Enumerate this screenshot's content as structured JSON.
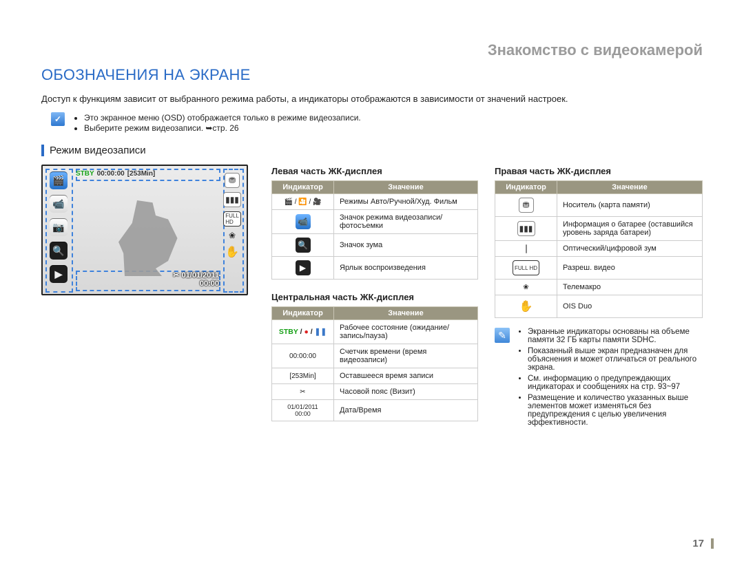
{
  "breadcrumb": "Знакомство с видеокамерой",
  "title": "ОБОЗНАЧЕНИЯ НА ЭКРАНЕ",
  "intro": "Доступ к функциям зависит от выбранного режима работы, а индикаторы отображаются в зависимости от значений настроек.",
  "topInfo": {
    "line1": "Это экранное меню (OSD) отображается только в режиме видеозаписи.",
    "line2": "Выберите режим видеозаписи. ➥стр. 26"
  },
  "sectionTitle": "Режим видеозаписи",
  "lcd": {
    "stby": "STBY",
    "time": "00:00:00",
    "remain": "[253Min]",
    "date": "01/01/2011",
    "clock": "00:00"
  },
  "tableHeaders": {
    "indicator": "Индикатор",
    "meaning": "Значение"
  },
  "left": {
    "title": "Левая часть ЖК-дисплея",
    "rows": [
      {
        "icon": "modes-icons",
        "label": "🎬 / 🎦 / 🎥",
        "meaning": "Режимы Авто/Ручной/Худ. Фильм"
      },
      {
        "icon": "video-mode-icon",
        "label": "📹",
        "meaning": "Значок режима видеозаписи/ фотосъемки"
      },
      {
        "icon": "zoom-icon",
        "label": "🔍",
        "meaning": "Значок зума"
      },
      {
        "icon": "play-icon",
        "label": "▶",
        "meaning": "Ярлык воспроизведения"
      }
    ]
  },
  "center": {
    "title": "Центральная часть ЖК-дисплея",
    "rows": [
      {
        "icon": "status-icon",
        "label_html": "STBY / ● / ❚❚",
        "meaning": "Рабочее состояние (ожидание/ запись/пауза)"
      },
      {
        "icon": "counter-icon",
        "label": "00:00:00",
        "meaning": "Счетчик времени (время видеозаписи)"
      },
      {
        "icon": "remain-icon",
        "label": "[253Min]",
        "meaning": "Оставшееся время записи"
      },
      {
        "icon": "timezone-icon",
        "label": "✂",
        "meaning": "Часовой пояс (Визит)"
      },
      {
        "icon": "datetime-icon",
        "label": "01/01/2011\n00:00",
        "meaning": "Дата/Время"
      }
    ]
  },
  "right": {
    "title": "Правая часть ЖК-дисплея",
    "rows": [
      {
        "icon": "sd-icon",
        "meaning": "Носитель (карта памяти)"
      },
      {
        "icon": "battery-icon",
        "meaning": "Информация о батарее (оставшийся уровень заряда батареи)"
      },
      {
        "icon": "optzoom-icon",
        "meaning": "Оптический/цифровой зум"
      },
      {
        "icon": "fullhd-icon",
        "meaning": "Разреш. видео"
      },
      {
        "icon": "telemacro-icon",
        "meaning": "Телемакро"
      },
      {
        "icon": "ois-icon",
        "meaning": "OIS Duo"
      }
    ]
  },
  "notes": [
    "Экранные индикаторы основаны на объеме памяти 32 ГБ карты памяти SDHC.",
    "Показанный выше экран предназначен для объяснения и может отличаться от реального экрана.",
    "См. информацию о предупреждающих индикаторах и сообщениях на стр. 93~97",
    "Размещение и количество указанных выше элементов может изменяться без предупреждения с целью увеличения эффективности."
  ],
  "pageNumber": "17"
}
